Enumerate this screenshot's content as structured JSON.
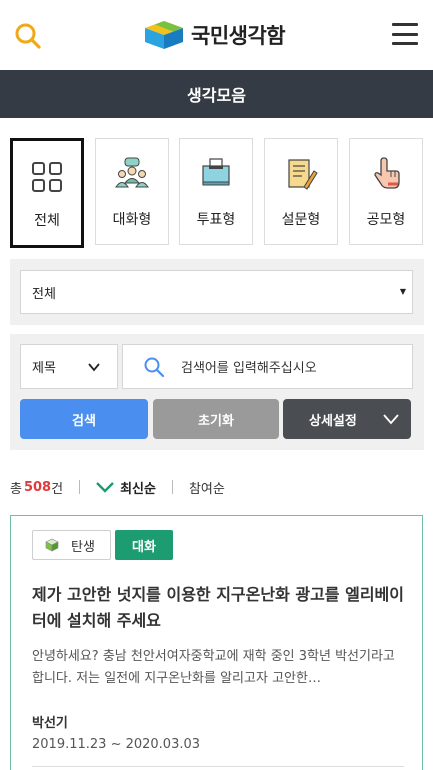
{
  "header": {
    "logo_text": "국민생각함",
    "search_icon": "search-icon",
    "menu_icon": "hamburger-menu-icon"
  },
  "titlebar": {
    "title": "생각모음"
  },
  "categories": [
    {
      "label": "전체",
      "icon": "grid-icon",
      "active": true
    },
    {
      "label": "대화형",
      "icon": "people-icon",
      "active": false
    },
    {
      "label": "투표형",
      "icon": "ballot-box-icon",
      "active": false
    },
    {
      "label": "설문형",
      "icon": "survey-icon",
      "active": false
    },
    {
      "label": "공모형",
      "icon": "hand-pointer-icon",
      "active": false
    }
  ],
  "filter": {
    "selected": "전체"
  },
  "search": {
    "field": "제목",
    "placeholder": "검색어를 입력해주십시오",
    "search_label": "검색",
    "reset_label": "초기화",
    "advanced_label": "상세설정"
  },
  "summary": {
    "total_prefix": "총",
    "count": "508",
    "count_suffix": "건",
    "sort_latest": "최신순",
    "sort_participation": "참여순"
  },
  "posts": [
    {
      "stage": "탄생",
      "type": "대화",
      "title": "제가 고안한 넛지를 이용한 지구온난화 광고를 엘리베이터에 설치해 주세요",
      "excerpt": "안녕하세요? 충남 천안서여자중학교에 재학 중인 3학년 박선기라고 합니다. 저는 일전에 지구온난화를 알리고자 고안한…",
      "author": "박선기",
      "period": "2019.11.23 ~ 2020.03.03"
    }
  ],
  "colors": {
    "titlebar_bg": "#353b44",
    "search_btn": "#4a8ef0",
    "reset_btn": "#9a9a9a",
    "advanced_btn": "#4a4d52",
    "count": "#e03a3a",
    "type_tag": "#1d9c72",
    "card_border": "#6fbfa6"
  }
}
